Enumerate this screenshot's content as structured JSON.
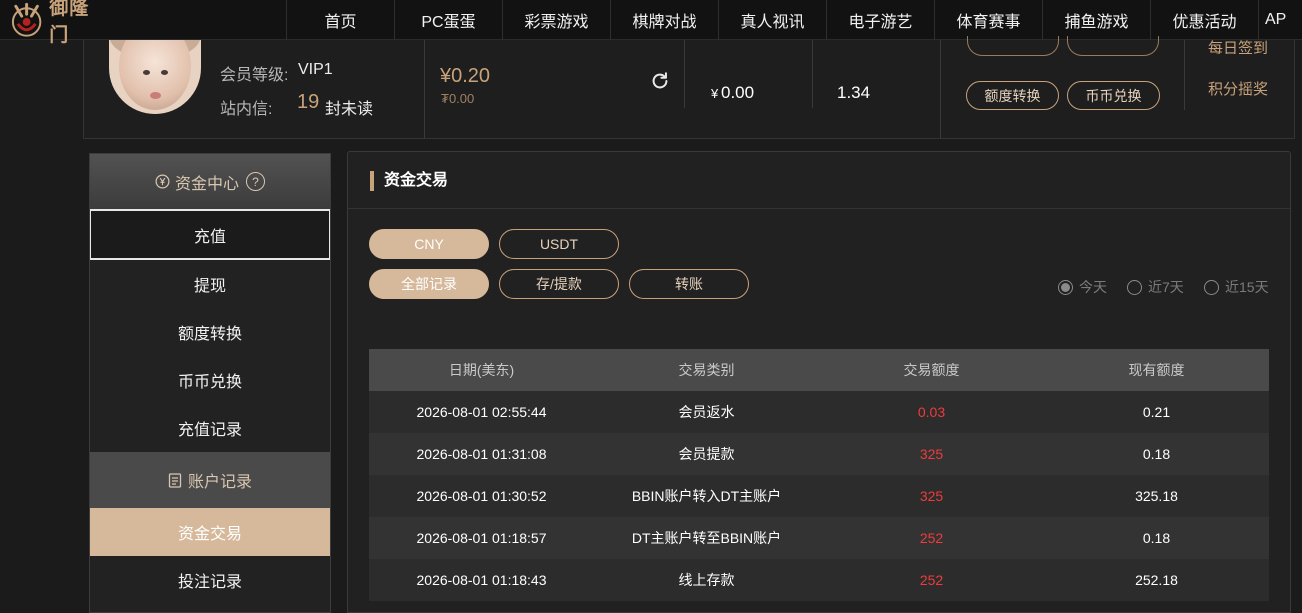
{
  "brand": {
    "name": "御隆门",
    "accent": "#c8a27a",
    "amount_color": "#ef3b3b"
  },
  "nav": {
    "items": [
      "首页",
      "PC蛋蛋",
      "彩票游戏",
      "棋牌对战",
      "真人视讯",
      "电子游艺",
      "体育赛事",
      "捕鱼游戏",
      "优惠活动",
      "AP"
    ]
  },
  "user": {
    "level_label": "会员等级:",
    "level_value": "VIP1",
    "msg_label": "站内信:",
    "msg_count": "19",
    "msg_suffix": "封未读"
  },
  "balance": {
    "main": "¥0.20",
    "sub": "₮0.00",
    "stat1_currency": "¥",
    "stat1_value": "0.00",
    "stat2_value": "1.34"
  },
  "actions": {
    "transfer_label": "额度转换",
    "coin_exchange_label": "币币兑换",
    "lottery_wheel_label": "积分摇奖",
    "daily_checkin_label": "每日签到"
  },
  "sidebar": {
    "header": "资金中心",
    "help": "?",
    "items": [
      "充值",
      "提现",
      "额度转换",
      "币币兑换",
      "充值记录"
    ],
    "section2": "账户记录",
    "items2": [
      "资金交易",
      "投注记录"
    ]
  },
  "main": {
    "title": "资金交易",
    "currency_tabs": [
      "CNY",
      "USDT"
    ],
    "filter_tabs": [
      "全部记录",
      "存/提款",
      "转账"
    ],
    "range_options": [
      "今天",
      "近7天",
      "近15天"
    ]
  },
  "table": {
    "headers": [
      "日期(美东)",
      "交易类别",
      "交易额度",
      "现有额度"
    ],
    "rows": [
      [
        "2026-08-01 02:55:44",
        "会员返水",
        "0.03",
        "0.21"
      ],
      [
        "2026-08-01 01:31:08",
        "会员提款",
        "325",
        "0.18"
      ],
      [
        "2026-08-01 01:30:52",
        "BBIN账户转入DT主账户",
        "325",
        "325.18"
      ],
      [
        "2026-08-01 01:18:57",
        "DT主账户转至BBIN账户",
        "252",
        "0.18"
      ],
      [
        "2026-08-01 01:18:43",
        "线上存款",
        "252",
        "252.18"
      ]
    ]
  }
}
